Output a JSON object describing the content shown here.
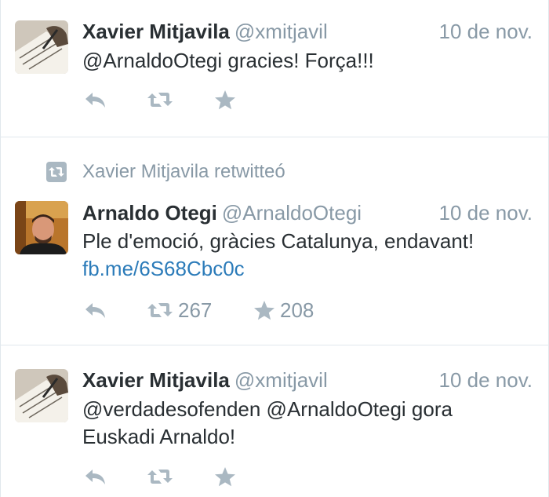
{
  "colors": {
    "name": "#292f33",
    "meta": "#8899a6",
    "icon": "#aab8c2",
    "link": "#2b7bb9",
    "divider": "#e1e8ed"
  },
  "icons": [
    "reply-icon",
    "retweet-icon",
    "favorite-star-icon",
    "retweet-badge-icon"
  ],
  "tweets": [
    {
      "author_name": "Xavier Mitjavila",
      "handle": "@xmitjavil",
      "date": "10 de nov.",
      "text_line1": "@ArnaldoOtegi gracies! Força!!!",
      "retweets": "",
      "favorites": ""
    },
    {
      "retweet_context": "Xavier Mitjavila retwitteó",
      "author_name": "Arnaldo Otegi",
      "handle": "@ArnaldoOtegi",
      "date": "10 de nov.",
      "text_line1": "Ple d'emoció, gràcies Catalunya, endavant!",
      "link": "fb.me/6S68Cbc0c",
      "retweets": "267",
      "favorites": "208"
    },
    {
      "author_name": "Xavier Mitjavila",
      "handle": "@xmitjavil",
      "date": "10 de nov.",
      "text_line1": "@verdadesofenden @ArnaldoOtegi gora",
      "text_line2": "Euskadi Arnaldo!",
      "retweets": "",
      "favorites": ""
    }
  ]
}
